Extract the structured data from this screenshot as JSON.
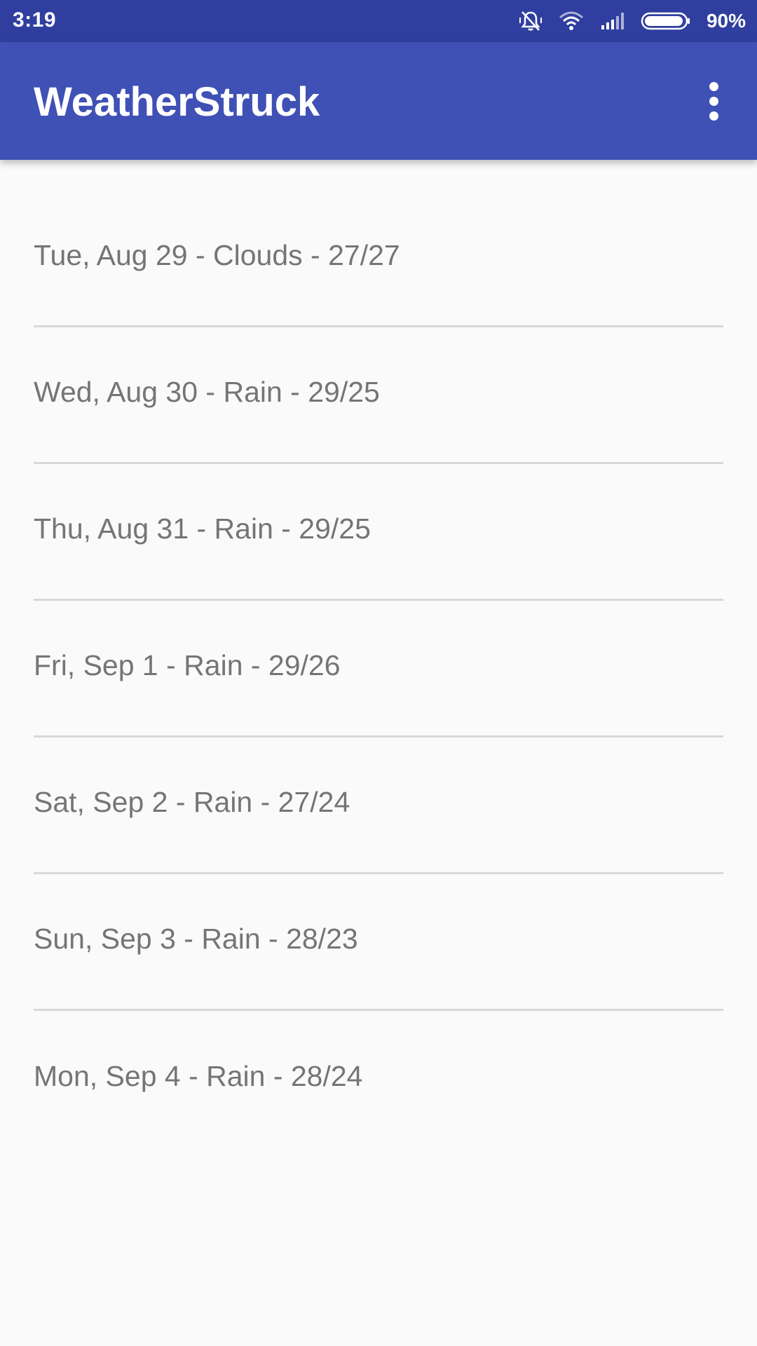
{
  "status_bar": {
    "time": "3:19",
    "battery": "90%",
    "icons": [
      "mute-vibrate-icon",
      "wifi-icon",
      "signal-icon",
      "battery-icon"
    ]
  },
  "app_bar": {
    "title": "WeatherStruck",
    "menu_icon": "more-vert-icon",
    "color": "#3f51b5"
  },
  "forecast": [
    {
      "label": "Tue, Aug 29 - Clouds - 27/27"
    },
    {
      "label": "Wed, Aug 30 - Rain - 29/25"
    },
    {
      "label": "Thu, Aug 31 - Rain - 29/25"
    },
    {
      "label": "Fri, Sep 1 - Rain - 29/26"
    },
    {
      "label": "Sat, Sep 2 - Rain - 27/24"
    },
    {
      "label": "Sun, Sep 3 - Rain - 28/23"
    },
    {
      "label": "Mon, Sep 4 - Rain - 28/24"
    }
  ]
}
